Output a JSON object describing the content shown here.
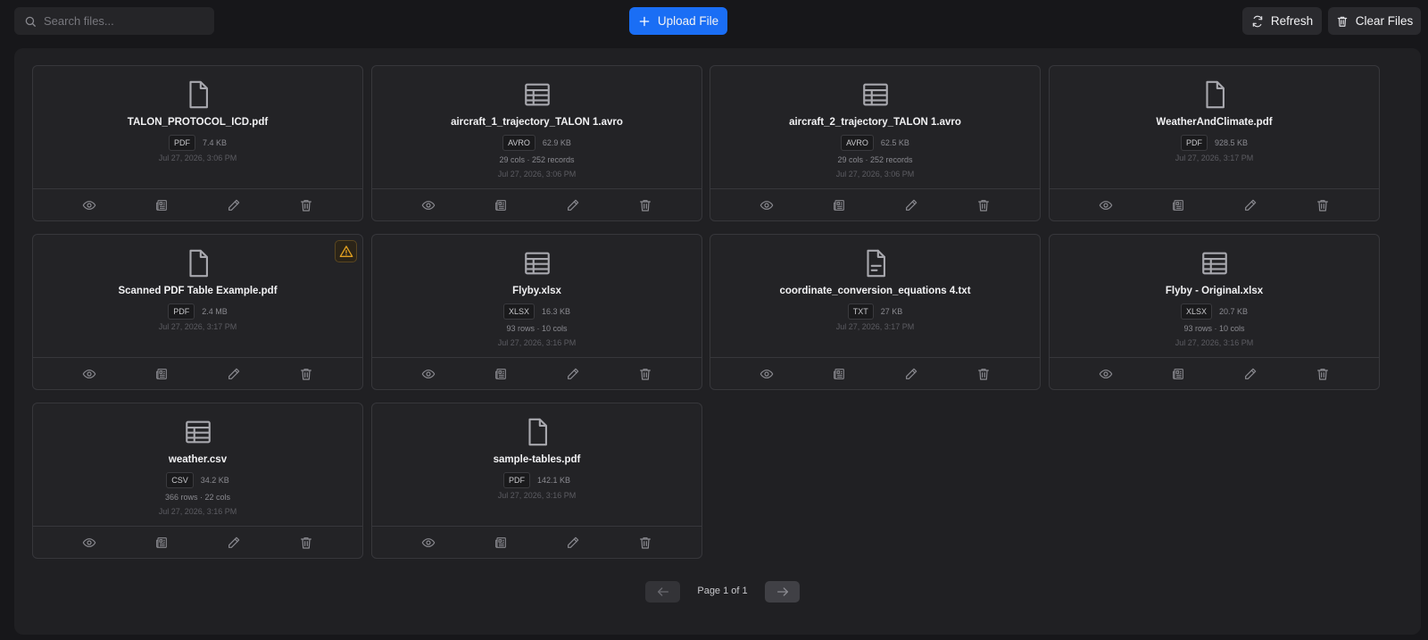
{
  "toolbar": {
    "search_placeholder": "Search files...",
    "upload_label": "Upload File",
    "refresh_label": "Refresh",
    "clear_label": "Clear Files"
  },
  "files": [
    {
      "name": "TALON_PROTOCOL_ICD.pdf",
      "type": "PDF",
      "size": "7.4 KB",
      "info": "",
      "date": "Jul 27, 2026, 3:06 PM",
      "icon": "document-icon",
      "warning": false
    },
    {
      "name": "aircraft_1_trajectory_TALON 1.avro",
      "type": "AVRO",
      "size": "62.9 KB",
      "info": "29 cols · 252 records",
      "date": "Jul 27, 2026, 3:06 PM",
      "icon": "table-icon",
      "warning": false
    },
    {
      "name": "aircraft_2_trajectory_TALON 1.avro",
      "type": "AVRO",
      "size": "62.5 KB",
      "info": "29 cols · 252 records",
      "date": "Jul 27, 2026, 3:06 PM",
      "icon": "table-icon",
      "warning": false
    },
    {
      "name": "WeatherAndClimate.pdf",
      "type": "PDF",
      "size": "928.5 KB",
      "info": "",
      "date": "Jul 27, 2026, 3:17 PM",
      "icon": "document-icon",
      "warning": false
    },
    {
      "name": "Scanned PDF Table Example.pdf",
      "type": "PDF",
      "size": "2.4 MB",
      "info": "",
      "date": "Jul 27, 2026, 3:17 PM",
      "icon": "document-icon",
      "warning": true
    },
    {
      "name": "Flyby.xlsx",
      "type": "XLSX",
      "size": "16.3 KB",
      "info": "93 rows · 10 cols",
      "date": "Jul 27, 2026, 3:16 PM",
      "icon": "table-icon",
      "warning": false
    },
    {
      "name": "coordinate_conversion_equations 4.txt",
      "type": "TXT",
      "size": "27 KB",
      "info": "",
      "date": "Jul 27, 2026, 3:17 PM",
      "icon": "text-file-icon",
      "warning": false
    },
    {
      "name": "Flyby - Original.xlsx",
      "type": "XLSX",
      "size": "20.7 KB",
      "info": "93 rows · 10 cols",
      "date": "Jul 27, 2026, 3:16 PM",
      "icon": "table-icon",
      "warning": false
    },
    {
      "name": "weather.csv",
      "type": "CSV",
      "size": "34.2 KB",
      "info": "366 rows · 22 cols",
      "date": "Jul 27, 2026, 3:16 PM",
      "icon": "table-icon",
      "warning": false
    },
    {
      "name": "sample-tables.pdf",
      "type": "PDF",
      "size": "142.1 KB",
      "info": "",
      "date": "Jul 27, 2026, 3:16 PM",
      "icon": "document-icon",
      "warning": false
    }
  ],
  "pagination": {
    "label": "Page 1 of 1"
  },
  "colors": {
    "accent": "#1a6ef5",
    "warning": "#e0a021"
  }
}
